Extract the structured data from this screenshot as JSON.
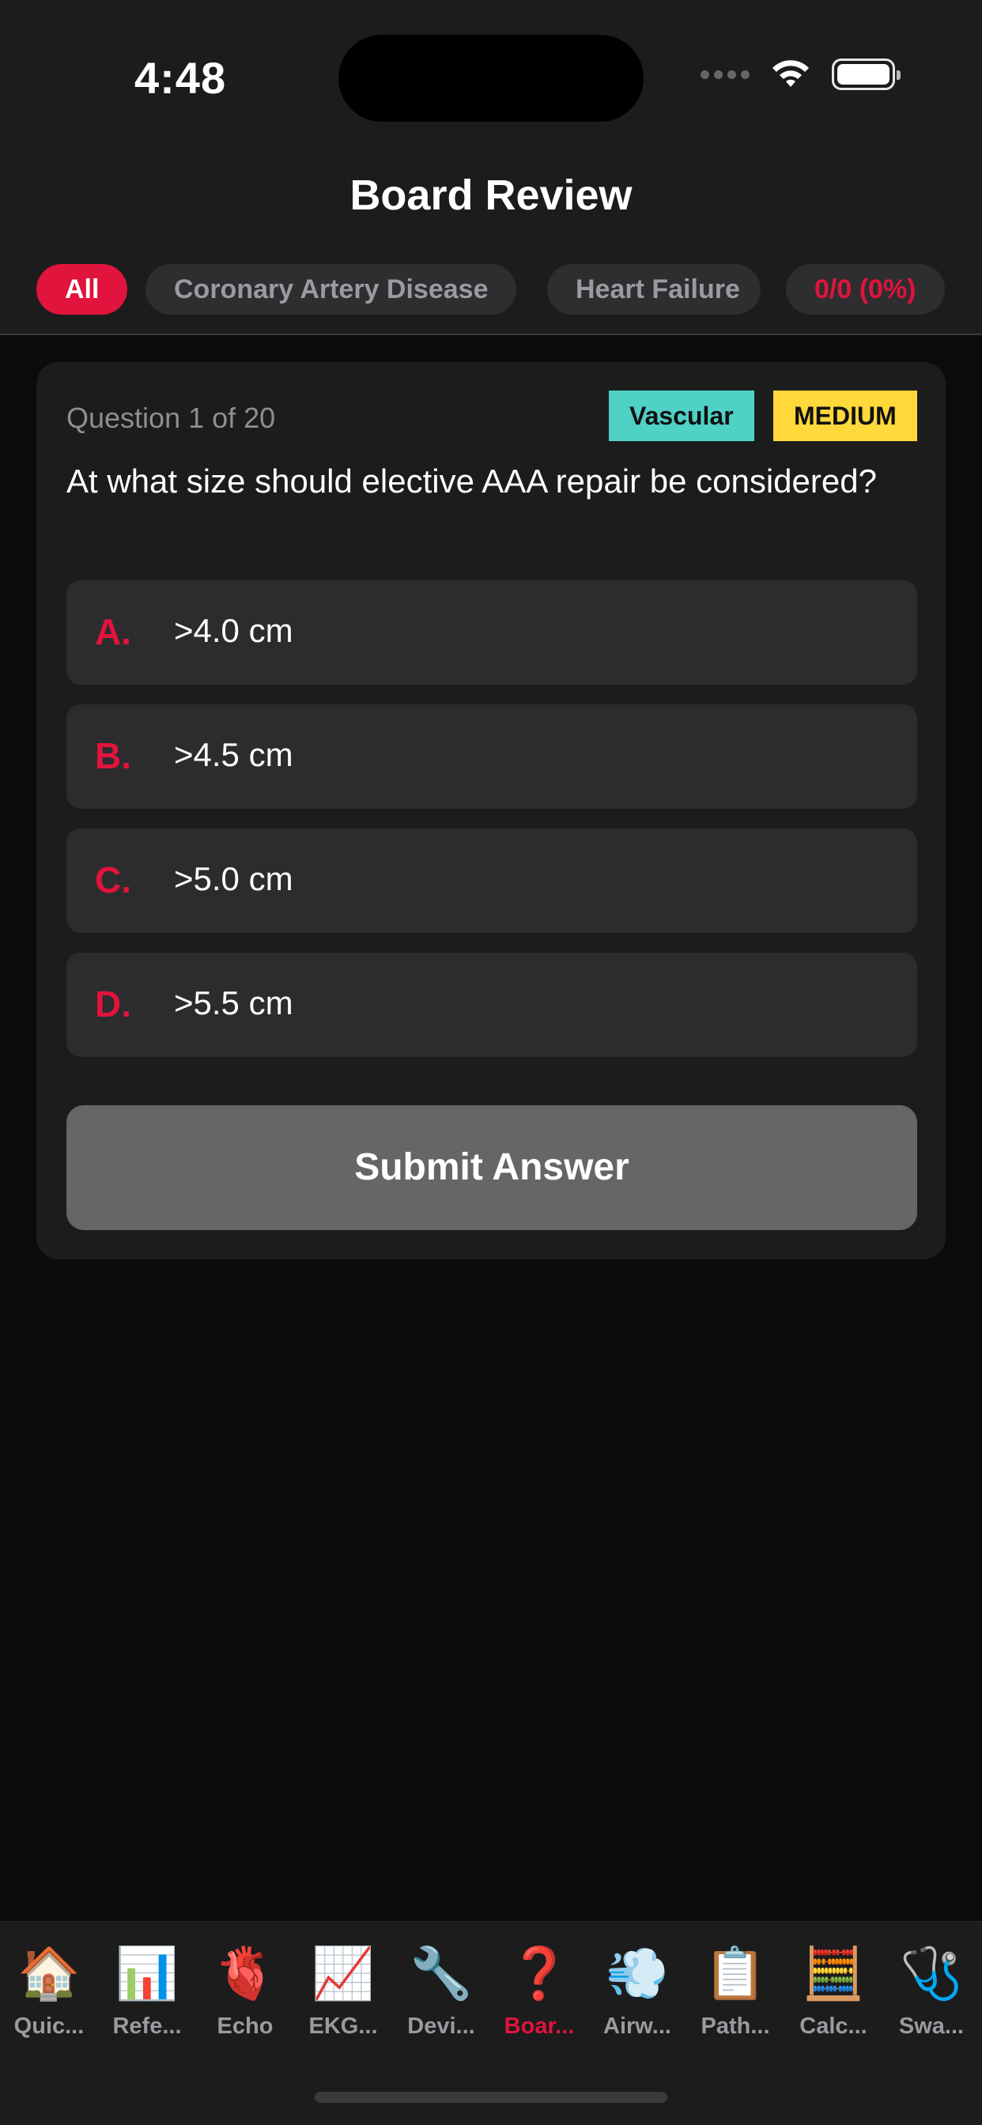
{
  "status_bar": {
    "time": "4:48"
  },
  "header": {
    "title": "Board Review"
  },
  "filters": {
    "chips": [
      {
        "label": "All"
      },
      {
        "label": "Coronary Artery Disease"
      },
      {
        "label": "Heart Failure"
      }
    ],
    "score": "0/0 (0%)"
  },
  "question": {
    "counter": "Question 1 of 20",
    "category": "Vascular",
    "difficulty": "MEDIUM",
    "text": "At what size should elective AAA repair be considered?",
    "options": [
      {
        "letter": "A.",
        "text": ">4.0 cm"
      },
      {
        "letter": "B.",
        "text": ">4.5 cm"
      },
      {
        "letter": "C.",
        "text": ">5.0 cm"
      },
      {
        "letter": "D.",
        "text": ">5.5 cm"
      }
    ],
    "submit_label": "Submit Answer"
  },
  "tabbar": {
    "items": [
      {
        "icon": "🏠",
        "label": "Quic..."
      },
      {
        "icon": "📊",
        "label": "Refe..."
      },
      {
        "icon": "🫀",
        "label": "Echo"
      },
      {
        "icon": "📈",
        "label": "EKG..."
      },
      {
        "icon": "🔧",
        "label": "Devi..."
      },
      {
        "icon": "❓",
        "label": "Boar..."
      },
      {
        "icon": "💨",
        "label": "Airw..."
      },
      {
        "icon": "📋",
        "label": "Path..."
      },
      {
        "icon": "🧮",
        "label": "Calc..."
      },
      {
        "icon": "🩺",
        "label": "Swa..."
      }
    ]
  },
  "colors": {
    "accent": "#e0143c",
    "tag_vascular": "#4fd1c5",
    "tag_medium": "#ffd83b",
    "submit_disabled": "#666666"
  }
}
